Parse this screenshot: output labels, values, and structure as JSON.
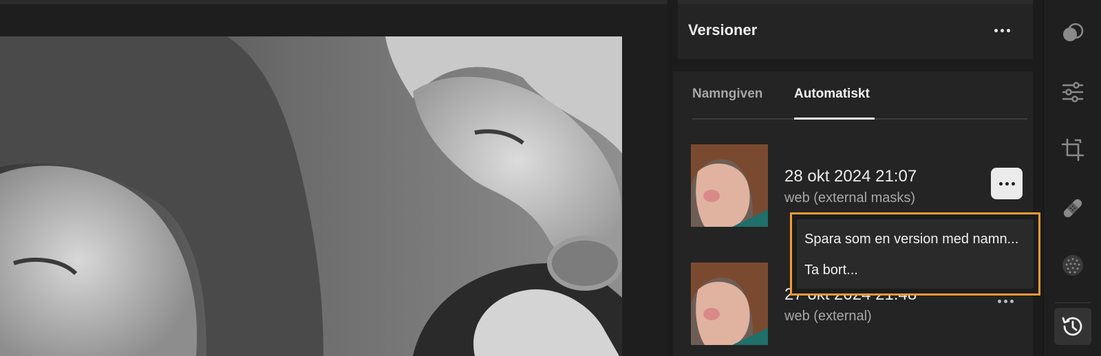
{
  "panel": {
    "title": "Versioner"
  },
  "tabs": [
    {
      "label": "Namngiven",
      "active": false
    },
    {
      "label": "Automatiskt",
      "active": true
    }
  ],
  "versions": [
    {
      "date": "28 okt 2024 21:07",
      "tag": "web (external masks)"
    },
    {
      "date": "27 okt 2024 21:48",
      "tag": "web (external)"
    }
  ],
  "context_menu": {
    "items": [
      "Spara som en version med namn...",
      "Ta bort..."
    ],
    "highlight_color": "#f39a33"
  },
  "rail": {
    "tools": [
      "mix-icon",
      "sliders-icon",
      "crop-icon",
      "bandage-icon",
      "grain-icon",
      "history-icon"
    ],
    "active_tool": "history-icon"
  },
  "colors": {
    "background": "#1b1b1b",
    "panel": "#242424",
    "accent_outline": "#f39a33"
  }
}
